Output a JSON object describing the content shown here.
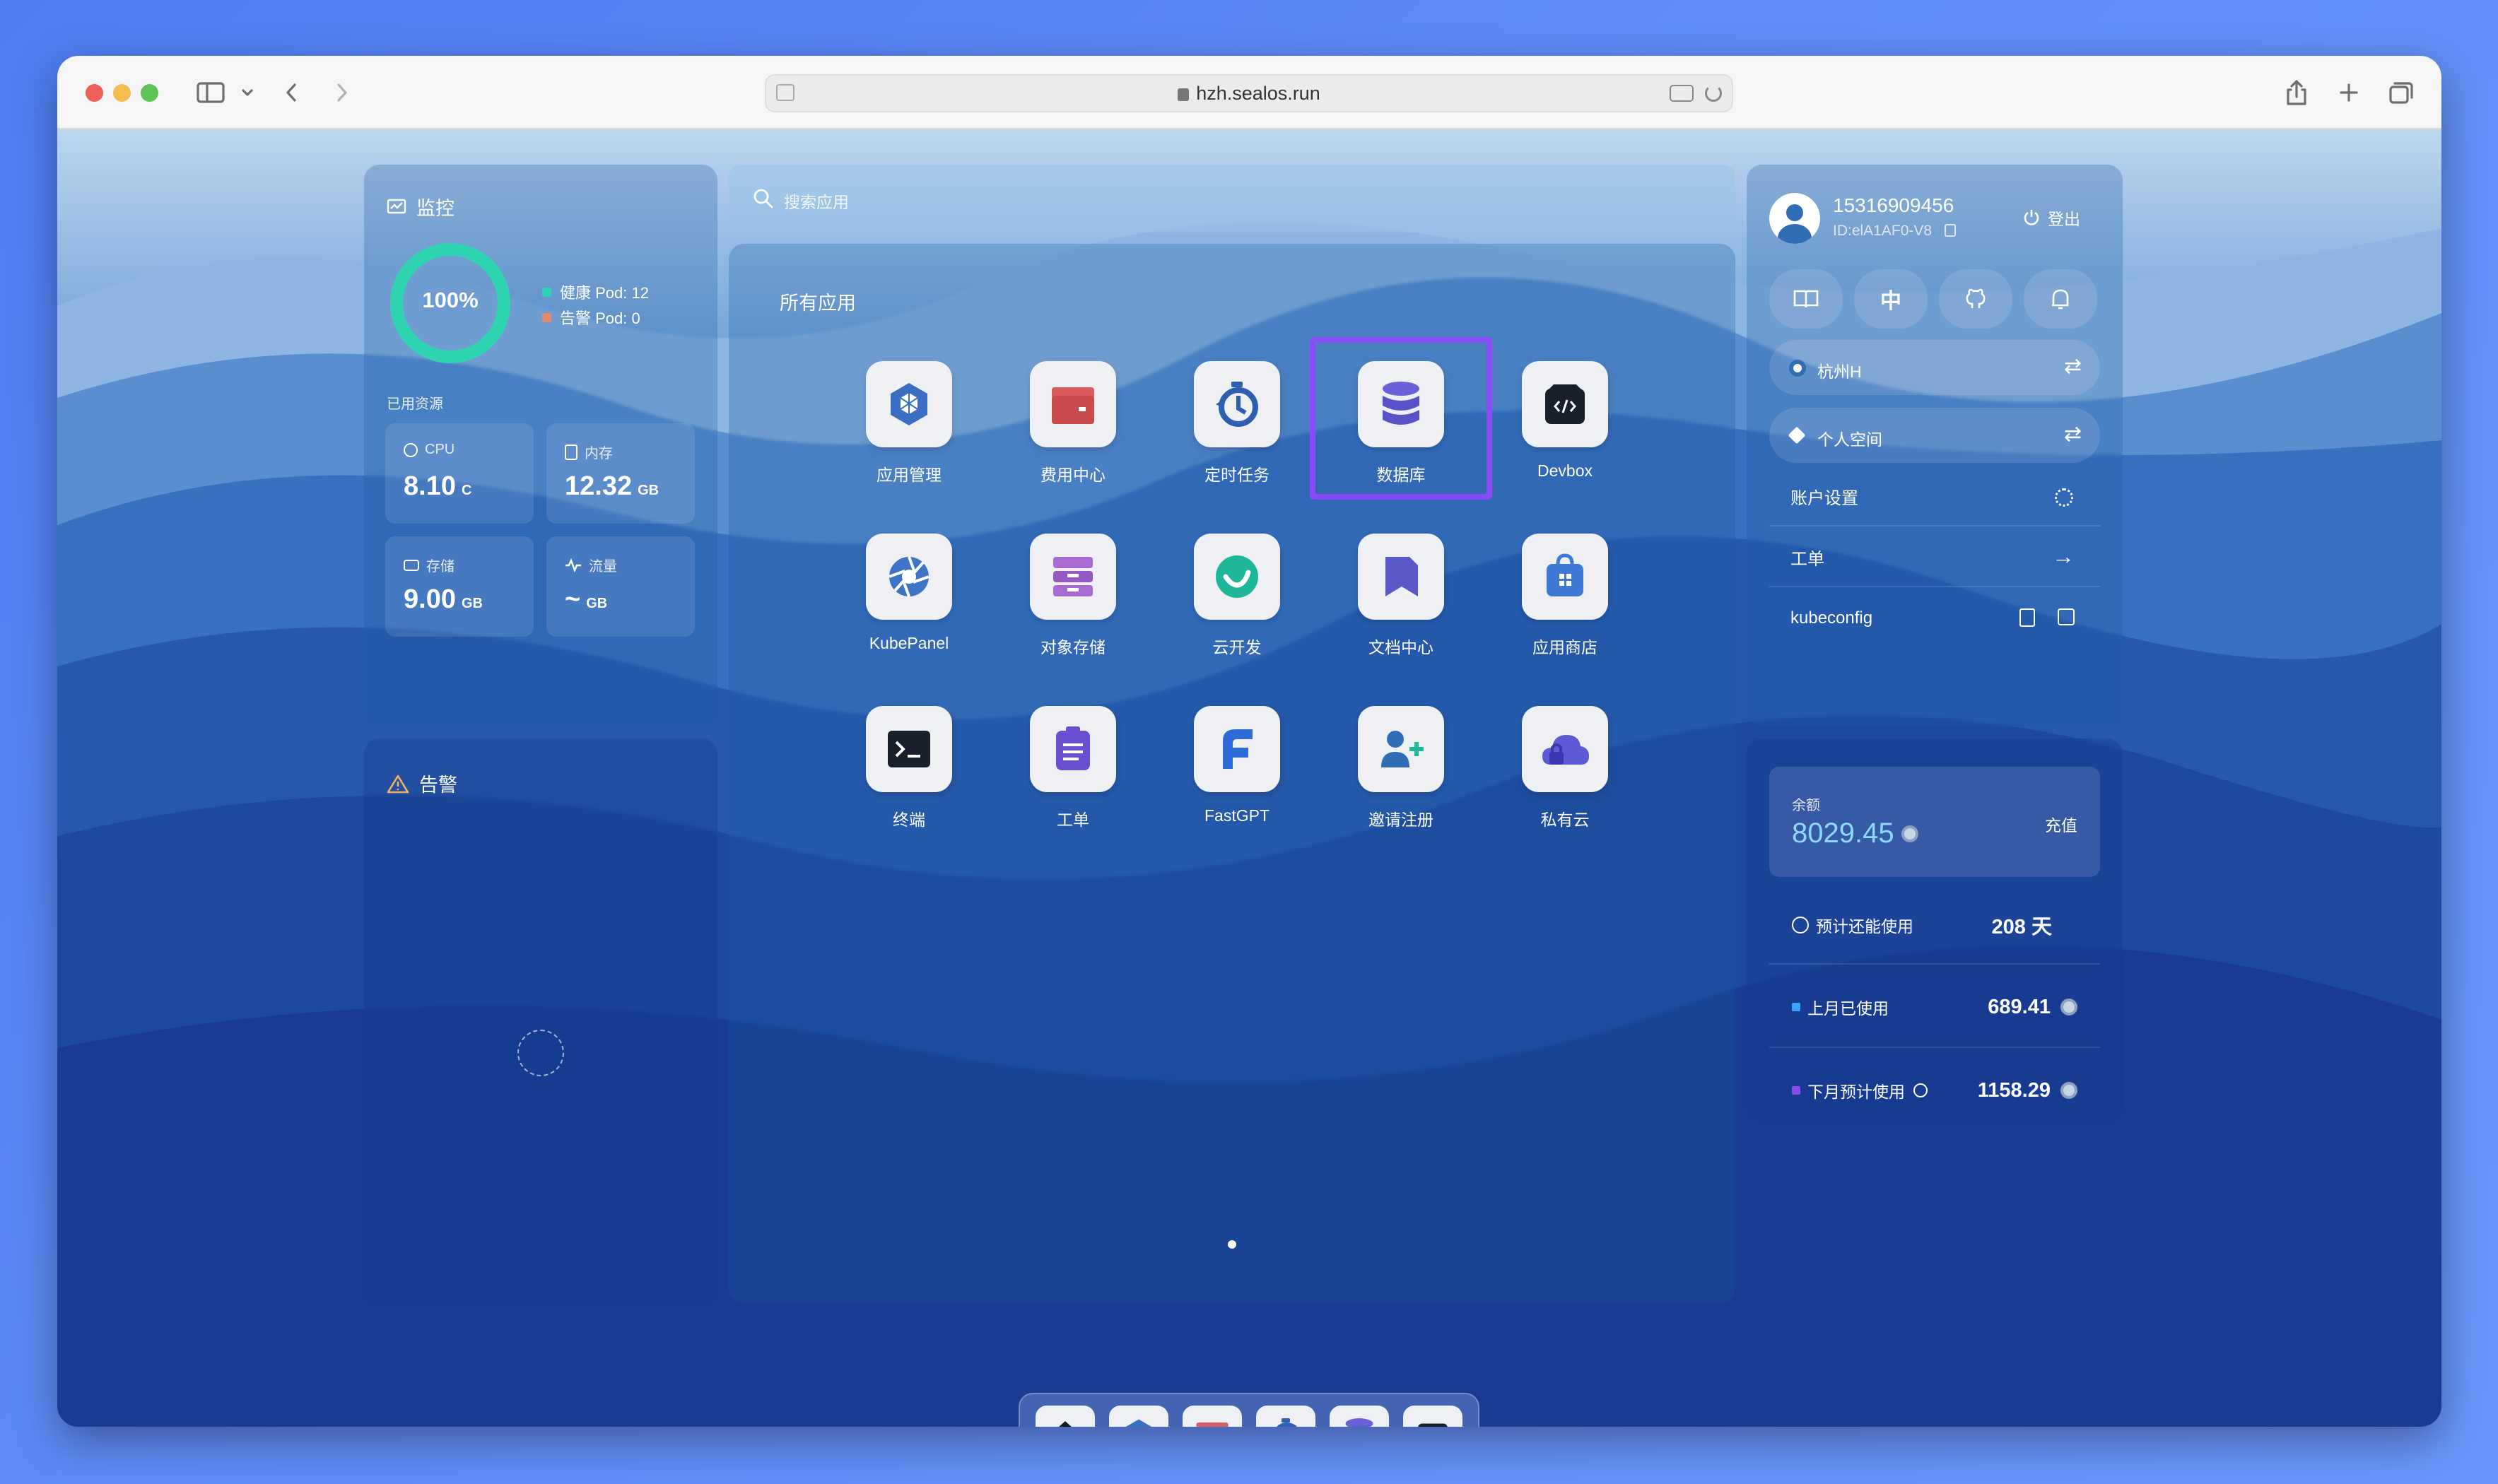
{
  "browser": {
    "url": "hzh.sealos.run"
  },
  "search": {
    "placeholder": "搜索应用"
  },
  "monitor": {
    "title": "监控",
    "health_percent": "100%",
    "health_fraction": 1.0,
    "healthy_pods": "健康 Pod: 12",
    "warning_pods": "告警 Pod: 0",
    "used_resources_label": "已用资源",
    "cpu": {
      "label": "CPU",
      "value": "8.10",
      "unit": "C"
    },
    "memory": {
      "label": "内存",
      "value": "12.32",
      "unit": "GB"
    },
    "storage": {
      "label": "存储",
      "value": "9.00",
      "unit": "GB"
    },
    "traffic": {
      "label": "流量",
      "value": "~",
      "unit": "GB"
    }
  },
  "alerts": {
    "title": "告警"
  },
  "apps": {
    "section_title": "所有应用",
    "items": [
      {
        "label": "应用管理",
        "icon": "hexagon-cube-icon"
      },
      {
        "label": "费用中心",
        "icon": "wallet-icon"
      },
      {
        "label": "定时任务",
        "icon": "timer-icon"
      },
      {
        "label": "数据库",
        "icon": "database-icon"
      },
      {
        "label": "Devbox",
        "icon": "code-box-icon"
      },
      {
        "label": "KubePanel",
        "icon": "aperture-icon"
      },
      {
        "label": "对象存储",
        "icon": "archive-icon"
      },
      {
        "label": "云开发",
        "icon": "check-cloud-icon"
      },
      {
        "label": "文档中心",
        "icon": "doc-bookmark-icon"
      },
      {
        "label": "应用商店",
        "icon": "store-bag-icon"
      },
      {
        "label": "终端",
        "icon": "terminal-icon"
      },
      {
        "label": "工单",
        "icon": "clipboard-icon"
      },
      {
        "label": "FastGPT",
        "icon": "fastgpt-icon"
      },
      {
        "label": "邀请注册",
        "icon": "invite-user-icon"
      },
      {
        "label": "私有云",
        "icon": "private-cloud-icon"
      }
    ]
  },
  "user": {
    "phone": "15316909456",
    "id": "ID:elA1AF0-V8",
    "logout": "登出",
    "lang": "中",
    "region": "杭州H",
    "workspace": "个人空间",
    "account_settings": "账户设置",
    "ticket": "工单",
    "kubeconfig": "kubeconfig"
  },
  "billing": {
    "balance_label": "余额",
    "balance": "8029.45",
    "recharge": "充值",
    "estimate_label": "预计还能使用",
    "estimate_value": "208 天",
    "last_month_label": "上月已使用",
    "last_month_value": "689.41",
    "next_month_label": "下月预计使用",
    "next_month_value": "1158.29"
  },
  "colors": {
    "accent": "#2ed3b0",
    "highlight": "#8b4cf6",
    "warning": "#e58a6a"
  }
}
